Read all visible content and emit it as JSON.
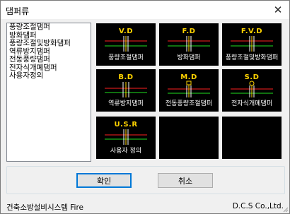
{
  "window": {
    "title": "댐퍼류",
    "close_glyph": "✕"
  },
  "list": {
    "items": [
      "풍량조절댐퍼",
      "방화댐퍼",
      "풍량조절및방화댐퍼",
      "역류방지댐퍼",
      "전동풍량댐퍼",
      "전자식개폐댐퍼",
      "사용자정의"
    ]
  },
  "tiles": [
    {
      "abbr": "V.D",
      "label": "풍량조절댐퍼",
      "icon": "damper-vd-icon"
    },
    {
      "abbr": "F.D",
      "label": "방화댐퍼",
      "icon": "damper-fd-icon"
    },
    {
      "abbr": "F.V.D",
      "label": "풍량조절및방화댐퍼",
      "icon": "damper-fvd-icon"
    },
    {
      "abbr": "B.D",
      "label": "역류방지댐퍼",
      "icon": "damper-bd-icon"
    },
    {
      "abbr": "M.D",
      "label": "전동풍량조절댐퍼",
      "icon": "damper-md-icon"
    },
    {
      "abbr": "S.D",
      "label": "전자식개폐댐퍼",
      "icon": "damper-sd-icon"
    },
    {
      "abbr": "U.S.R",
      "label": "사용자 정의",
      "icon": "damper-usr-icon"
    },
    {
      "abbr": "",
      "label": "",
      "icon": ""
    },
    {
      "abbr": "",
      "label": "",
      "icon": ""
    }
  ],
  "buttons": {
    "ok": "확인",
    "cancel": "취소"
  },
  "status": {
    "left": "건축소방설비시스템 Fire",
    "right": "D.C.S Co.,Ltd."
  },
  "colors": {
    "tile_bg": "#000000",
    "abbr": "#ffd400",
    "label": "#ffffff",
    "line_red": "#ff2020",
    "line_green": "#20e020",
    "accent": "#0078d7"
  }
}
